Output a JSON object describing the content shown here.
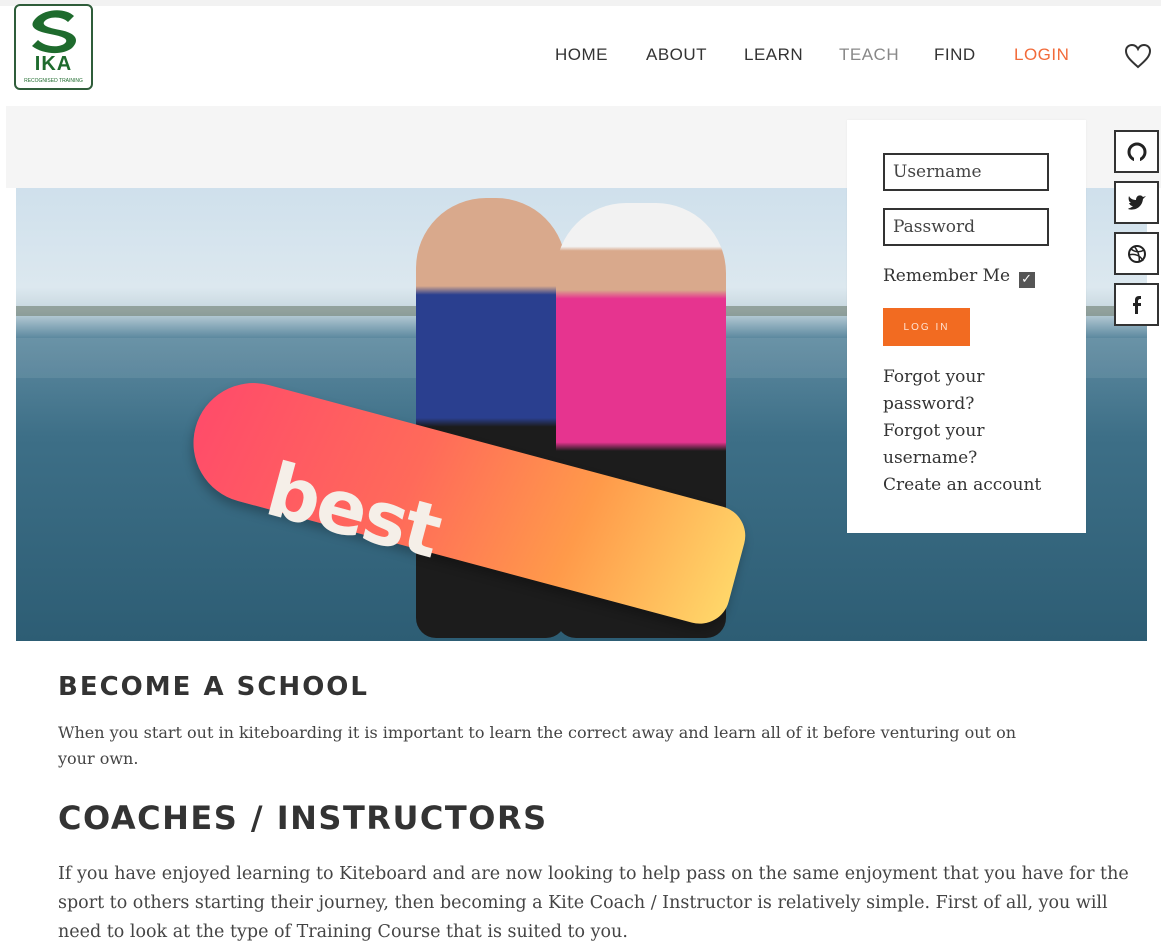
{
  "logo": {
    "text": "IKA",
    "subtext": "RECOGNISED TRAINING"
  },
  "nav": {
    "items": [
      {
        "label": "HOME"
      },
      {
        "label": "ABOUT"
      },
      {
        "label": "LEARN"
      },
      {
        "label": "TEACH"
      },
      {
        "label": "FIND"
      },
      {
        "label": "LOGIN"
      }
    ],
    "heart_icon": "heart-icon"
  },
  "hero": {
    "board_text": "best"
  },
  "login": {
    "username_placeholder": "Username",
    "password_placeholder": "Password",
    "remember_label": "Remember Me",
    "remember_checked": true,
    "button_label": "LOG IN",
    "forgot_password": [
      "Forgot your",
      "password?"
    ],
    "forgot_username": [
      "Forgot your",
      "username?"
    ],
    "create_account": "Create an account"
  },
  "social": [
    "github-icon",
    "twitter-icon",
    "dribbble-icon",
    "facebook-icon"
  ],
  "sections": [
    {
      "heading": "BECOME A SCHOOL",
      "lines": [
        "When you start out in kiteboarding it is important to learn the correct away and learn all of it before venturing out on",
        "your own."
      ]
    },
    {
      "heading": "COACHES / INSTRUCTORS",
      "lines": [
        "If you have enjoyed learning to Kiteboard and are now looking to help pass on the same enjoyment that you have for the",
        "sport to others starting their journey, then becoming a Kite Coach / Instructor is relatively simple. First of all, you will",
        "need to look at the type of Training Course that is suited to you."
      ]
    }
  ],
  "colors": {
    "accent": "#f26b21",
    "brand": "#1e6b2d",
    "text": "#333333"
  }
}
